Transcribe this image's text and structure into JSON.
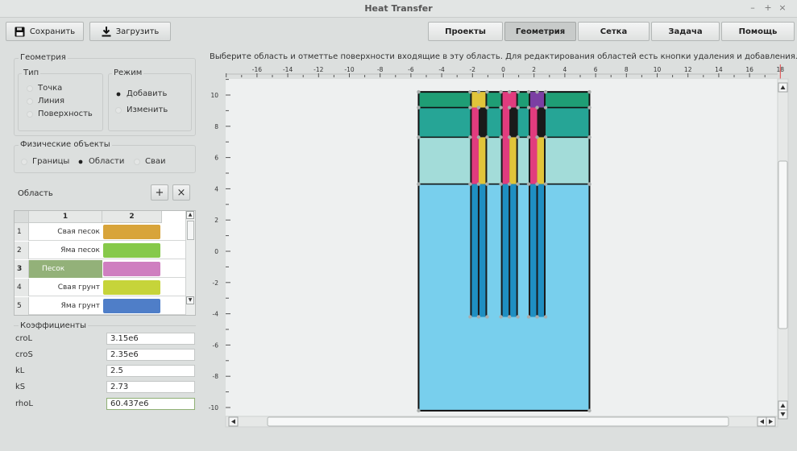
{
  "window": {
    "title": "Heat Transfer",
    "controls": [
      "–",
      "+",
      "×"
    ]
  },
  "toolbar": {
    "save_label": "Сохранить",
    "load_label": "Загрузить"
  },
  "nav": {
    "tabs": [
      "Проекты",
      "Геометрия",
      "Сетка",
      "Задача",
      "Помощь"
    ],
    "active": "Геометрия"
  },
  "geometry": {
    "title": "Геометрия",
    "type": {
      "title": "Тип",
      "options": [
        "Точка",
        "Линия",
        "Поверхность"
      ]
    },
    "mode": {
      "title": "Режим",
      "options": [
        "Добавить",
        "Изменить"
      ],
      "selected": "Добавить"
    }
  },
  "physical": {
    "title": "Физические объекты",
    "options": [
      "Границы",
      "Области",
      "Сваи"
    ],
    "selected": "Области"
  },
  "regions": {
    "title": "Область",
    "add_label": "+",
    "remove_label": "×",
    "columns": [
      "1",
      "2"
    ],
    "rows": [
      {
        "num": "1",
        "name": "Свая песок",
        "color": "#d8a43a"
      },
      {
        "num": "2",
        "name": "Яма песок",
        "color": "#86c94a"
      },
      {
        "num": "3",
        "name": "Песок",
        "color": "#cf7fc0",
        "selected": true
      },
      {
        "num": "4",
        "name": "Свая грунт",
        "color": "#c6d43a"
      },
      {
        "num": "5",
        "name": "Яма грунт",
        "color": "#4f7ec8"
      }
    ]
  },
  "coefficients": {
    "title": "Коэффициенты",
    "items": [
      {
        "label": "croL",
        "value": "3.15e6"
      },
      {
        "label": "croS",
        "value": "2.35e6"
      },
      {
        "label": "kL",
        "value": "2.5"
      },
      {
        "label": "kS",
        "value": "2.73"
      },
      {
        "label": "rhoL",
        "value": "60.437e6"
      }
    ]
  },
  "instructions": "Выберите область и отметтье поверхности входящие в эту область. Для редактирования областей есть кнопки удаления и добавления.",
  "plot": {
    "x_ticks": [
      "-16",
      "-14",
      "-12",
      "-10",
      "-8",
      "-6",
      "-4",
      "-2",
      "0",
      "2",
      "4",
      "6",
      "8",
      "10",
      "12",
      "14",
      "16",
      "18"
    ],
    "y_ticks": [
      "10",
      "8",
      "6",
      "4",
      "2",
      "0",
      "-2",
      "-4",
      "-6",
      "-8",
      "-10"
    ],
    "layer_colors": [
      "#1f9e75",
      "#26a596",
      "#a3dcd9",
      "#78cfed"
    ],
    "pile_colors": {
      "pink": "#e13c7e",
      "yellow": "#e1c43a",
      "purple": "#7b3fa3",
      "blue": "#1f8fc2",
      "dark": "#1a1a1a"
    }
  }
}
